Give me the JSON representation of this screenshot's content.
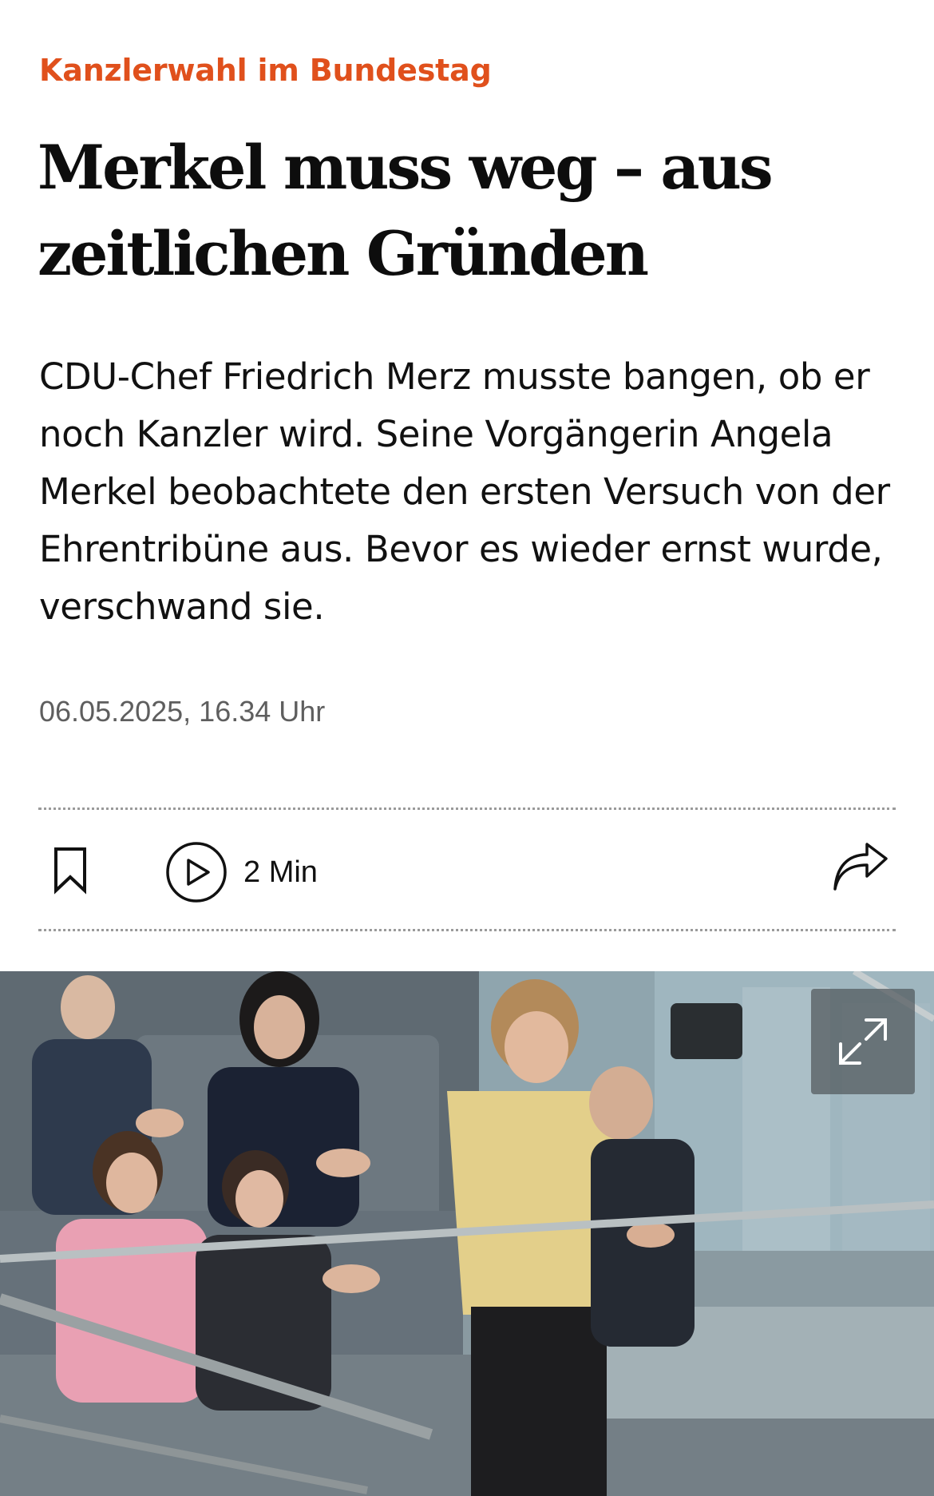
{
  "article": {
    "kicker": "Kanzlerwahl im Bundestag",
    "headline": "Merkel muss weg – aus zeitlichen Gründen",
    "teaser": "CDU-Chef Friedrich Merz musste bangen, ob er noch Kanzler wird. Seine Vorgängerin Angela Merkel beobachtete den ersten Versuch von der Ehrentribüne aus. Bevor es wieder ernst wurde, verschwand sie.",
    "timestamp": "06.05.2025, 16.34 Uhr"
  },
  "toolbar": {
    "bookmark_icon": "bookmark-icon",
    "audio_icon": "play-circle-icon",
    "audio_duration": "2 Min",
    "share_icon": "share-arrow-icon"
  },
  "image": {
    "expand_icon": "expand-arrows-icon"
  },
  "colors": {
    "kicker": "#e0501c",
    "headline": "#0d0d0d",
    "body_text": "#111111",
    "meta_text": "#5e5e5e",
    "divider": "#9a9a9a",
    "background": "#ffffff"
  }
}
